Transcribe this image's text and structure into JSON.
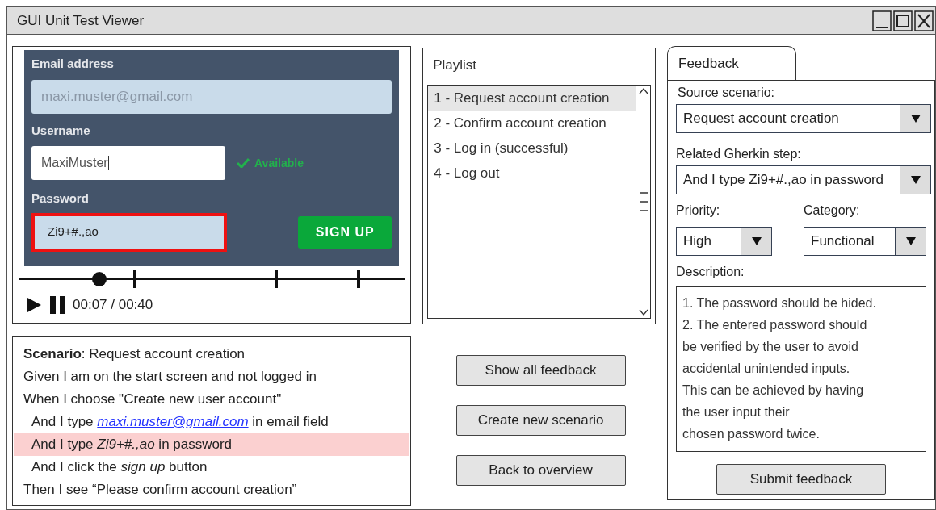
{
  "window": {
    "title": "GUI Unit Test Viewer"
  },
  "video": {
    "screen": {
      "email_label": "Email address",
      "email_value": "maxi.muster@gmail.com",
      "username_label": "Username",
      "username_value": "MaxiMuster",
      "availability": "Available",
      "password_label": "Password",
      "password_value": "Zi9+#.,ao",
      "password_highlighted": true,
      "sign_up": "SIGN UP"
    },
    "progress": {
      "level": 0.21
    },
    "time": "00:07 / 00:40"
  },
  "scenario": {
    "title": "**Scenario**: Request account creation",
    "steps": [
      {
        "text": "Given I am on the start screen and not logged in",
        "highlighted": false
      },
      {
        "text": "When I choose \"Create new user account\"",
        "highlighted": false,
        "children": [
          {
            "text": "And I type ",
            "link": "maxi.muster@gmail.com",
            "text_after": " in email field",
            "highlighted": false
          },
          {
            "text": "And I type *Zi9+#.,ao* in password",
            "highlighted": true
          },
          {
            "text": "And I click the *sign up* button",
            "highlighted": false
          }
        ]
      },
      {
        "text": "Then I see “Please confirm account creation”",
        "highlighted": false
      }
    ]
  },
  "playlist": {
    "title": "Playlist",
    "items": [
      {
        "label": "1 - Request account creation",
        "selected": true
      },
      {
        "label": "2 - Confirm account creation",
        "selected": false
      },
      {
        "label": "3 - Log in (successful)",
        "selected": false
      },
      {
        "label": "4 - Log out",
        "selected": false
      }
    ]
  },
  "actions": [
    "Show all feedback",
    "Create new scenario",
    "Back to overview"
  ],
  "feedback": {
    "tab": "Feedback",
    "source_label": "Source scenario:",
    "source_value": "Request account creation",
    "step_label": "Related Gherkin step:",
    "step_value": "And I type Zi9+#.,ao in password",
    "priority_label": "Priority:",
    "priority_value": "High",
    "category_label": "Category:",
    "category_value": "Functional",
    "description_label": "Description:",
    "description": "1. The password should be hided.\n2. The entered password should\nbe verified by the user to avoid\naccidental unintended inputs.\nThis can be achieved by having\nthe user input their\nchosen password twice.",
    "submit": "Submit feedback"
  }
}
